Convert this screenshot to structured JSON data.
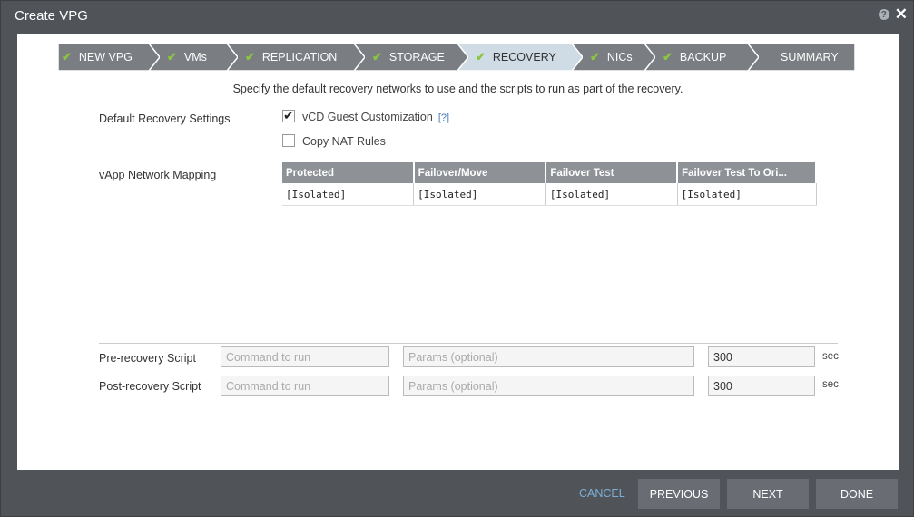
{
  "window": {
    "title": "Create VPG"
  },
  "wizard": {
    "steps": [
      {
        "label": "NEW VPG",
        "checked": true
      },
      {
        "label": "VMs",
        "checked": true
      },
      {
        "label": "REPLICATION",
        "checked": true
      },
      {
        "label": "STORAGE",
        "checked": true
      },
      {
        "label": "RECOVERY",
        "checked": true
      },
      {
        "label": "NICs",
        "checked": true
      },
      {
        "label": "BACKUP",
        "checked": true
      },
      {
        "label": "SUMMARY",
        "checked": false
      }
    ],
    "active_step": "RECOVERY"
  },
  "content": {
    "instruction": "Specify the default recovery networks to use and the scripts to run as part of the recovery.",
    "default_recovery_settings_label": "Default Recovery Settings",
    "vcd_customization": {
      "label": "vCD Guest Customization",
      "checked": true,
      "help": "[?]"
    },
    "copy_nat_rules": {
      "label": "Copy NAT Rules",
      "checked": false
    },
    "vapp_mapping_label": "vApp Network Mapping",
    "table": {
      "headers": [
        "Protected",
        "Failover/Move",
        "Failover Test",
        "Failover Test To Ori..."
      ],
      "rows": [
        [
          "[Isolated]",
          "[Isolated]",
          "[Isolated]",
          "[Isolated]"
        ]
      ]
    },
    "pre_script": {
      "label": "Pre-recovery Script",
      "command_placeholder": "Command to run",
      "params_placeholder": "Params (optional)",
      "timeout": "300",
      "unit": "sec"
    },
    "post_script": {
      "label": "Post-recovery Script",
      "command_placeholder": "Command to run",
      "params_placeholder": "Params (optional)",
      "timeout": "300",
      "unit": "sec"
    }
  },
  "footer": {
    "cancel": "CANCEL",
    "previous": "PREVIOUS",
    "next": "NEXT",
    "done": "DONE"
  },
  "colors": {
    "step_bg": "#7a7d82",
    "step_active_bg": "#cfdbe5",
    "accent_check": "#8cc63f",
    "cancel_link": "#7aaed6"
  }
}
